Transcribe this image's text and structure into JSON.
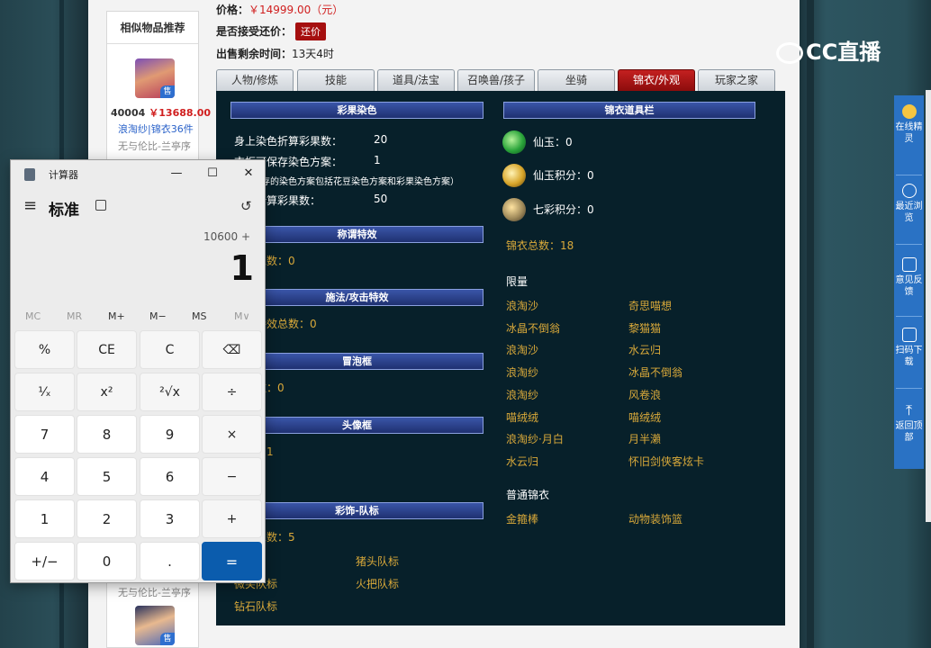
{
  "similar": {
    "title": "相似物品推荐",
    "item1": {
      "id": "40004",
      "price": "￥13688.00",
      "server": "浪淘纱|锦衣36件",
      "seller": "无与伦比-兰亭序"
    },
    "item2": {
      "seller_partial": "无与伦比-兰亭序"
    },
    "sell_badge": "售"
  },
  "header": {
    "price_label": "价格：",
    "price_value": "￥14999.00（元）",
    "bargain_label": "是否接受还价：",
    "bargain_button": "还价",
    "remain_label": "出售剩余时间：",
    "remain_value": "13天4时"
  },
  "tabs": [
    "人物/修炼",
    "技能",
    "道具/法宝",
    "召唤兽/孩子",
    "坐骑",
    "锦衣/外观",
    "玩家之家"
  ],
  "active_tab": "锦衣/外观",
  "content": {
    "dye_head": "彩果染色",
    "dye_count_label": "身上染色折算彩果数：",
    "dye_count_value": "20",
    "dye_scheme_label": "衣柜可保存染色方案：",
    "dye_scheme_value": "1",
    "dye_note": "（可保存的染色方案包括花豆染色方案和彩果染色方案）",
    "dye_count2_label": "染色折算彩果数：",
    "dye_count2_value": "50",
    "title_head": "称谓特效",
    "title_total": "特效总数：0",
    "spell_head": "施法/攻击特效",
    "spell_total": "攻击特效总数：0",
    "bubble_head": "冒泡框",
    "bubble_total": "框总数：0",
    "avatar_head": "头像框",
    "avatar_total": "总数：1",
    "avatar_item": "铃",
    "team_head": "彩饰-队标",
    "team_total": "队标总数：5",
    "team_items": [
      "队标",
      "猪头队标",
      "微笑队标",
      "火把队标",
      "钻石队标"
    ],
    "wardrobe_head": "锦衣道具栏",
    "jade_label": "仙玉：0",
    "jade_pts_label": "仙玉积分：0",
    "rainbow_pts_label": "七彩积分：0",
    "wardrobe_total": "锦衣总数：18",
    "limited_label": "限量",
    "limited_left": [
      "浪淘沙",
      "冰晶不倒翁",
      "浪淘沙",
      "浪淘纱",
      "浪淘纱",
      "喵绒绒",
      "浪淘纱·月白",
      "水云归"
    ],
    "limited_right": [
      "奇思喵想",
      "黎猫猫",
      "水云归",
      "冰晶不倒翁",
      "风卷浪",
      "喵绒绒",
      "月半瀨",
      "怀旧剑侠客炫卡"
    ],
    "normal_label": "普通锦衣",
    "normal_items": [
      "金箍棒",
      "动物装饰篮"
    ]
  },
  "calculator": {
    "title": "计算器",
    "mode": "标准",
    "expression": "10600 +",
    "display": "1",
    "memory": [
      "MC",
      "MR",
      "M+",
      "M−",
      "MS",
      "M∨"
    ],
    "keys": [
      [
        "%",
        "CE",
        "C",
        "⌫"
      ],
      [
        "¹⁄ₓ",
        "x²",
        "²√x",
        "÷"
      ],
      [
        "7",
        "8",
        "9",
        "×"
      ],
      [
        "4",
        "5",
        "6",
        "−"
      ],
      [
        "1",
        "2",
        "3",
        "+"
      ],
      [
        "+/−",
        "0",
        ".",
        "="
      ]
    ]
  },
  "sidebar": {
    "logo": "CC直播",
    "items": [
      {
        "label": "在线精灵",
        "icon": "sprite-icon"
      },
      {
        "label": "最近浏览",
        "icon": "clock-icon"
      },
      {
        "label": "意见反馈",
        "icon": "edit-icon"
      },
      {
        "label": "扫码下载",
        "icon": "qr-scan-icon"
      },
      {
        "label": "返回顶部",
        "icon": "back-to-top-icon"
      }
    ]
  }
}
